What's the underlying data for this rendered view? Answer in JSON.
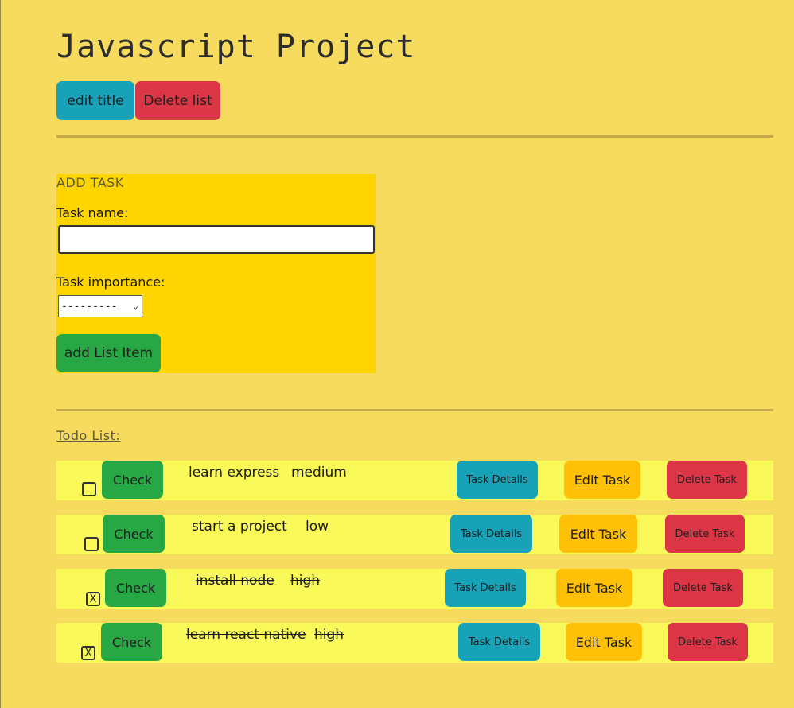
{
  "header": {
    "title": "Javascript Project",
    "edit_title_label": "edit title",
    "delete_list_label": "Delete list"
  },
  "add_task": {
    "heading": "ADD TASK",
    "name_label": "Task name:",
    "name_value": "",
    "importance_label": "Task importance:",
    "importance_selected": "---------",
    "submit_label": "add List Item"
  },
  "todo": {
    "heading": "Todo List:",
    "items": [
      {
        "name": "learn express",
        "importance": "medium",
        "checked": false,
        "checkbox_mark": "",
        "check_label": "Check",
        "details_label": "Task Details",
        "edit_label": "Edit Task",
        "delete_label": "Delete Task"
      },
      {
        "name": "start a project",
        "importance": "low",
        "checked": false,
        "checkbox_mark": "",
        "check_label": "Check",
        "details_label": "Task Details",
        "edit_label": "Edit Task",
        "delete_label": "Delete Task"
      },
      {
        "name": "install node",
        "importance": "high",
        "checked": true,
        "checkbox_mark": "X",
        "check_label": "Check",
        "details_label": "Task Details",
        "edit_label": "Edit Task",
        "delete_label": "Delete Task"
      },
      {
        "name": "learn react native",
        "importance": "high",
        "checked": true,
        "checkbox_mark": "X",
        "check_label": "Check",
        "details_label": "Task Details",
        "edit_label": "Edit Task",
        "delete_label": "Delete Task"
      }
    ]
  },
  "colors": {
    "background": "#f6db5e",
    "panel": "#ffd500",
    "row": "#f9f95a",
    "blue": "#17a2b8",
    "red": "#dc3545",
    "green": "#28a745",
    "amber": "#ffc107"
  }
}
